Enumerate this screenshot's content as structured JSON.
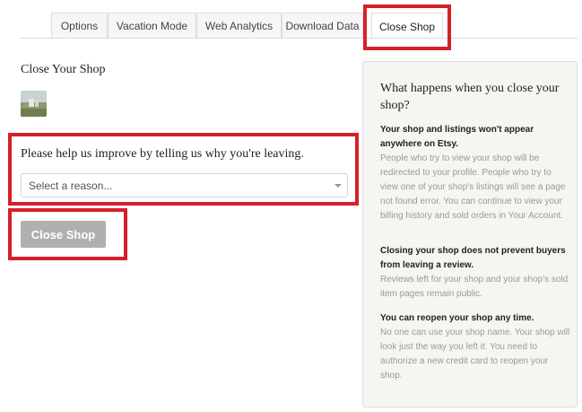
{
  "tabs": {
    "options": "Options",
    "vacation": "Vacation Mode",
    "analytics": "Web Analytics",
    "download": "Download Data",
    "close": "Close Shop"
  },
  "main": {
    "heading": "Close Your Shop",
    "reason_label": "Please help us improve by telling us why you're leaving.",
    "reason_placeholder": "Select a reason...",
    "close_button": "Close Shop"
  },
  "info": {
    "title": "What happens when you close your shop?",
    "sections": [
      {
        "bold": "Your shop and listings won't appear anywhere on Etsy.",
        "text": "People who try to view your shop will be redirected to your profile. People who try to view one of your shop's listings will see a page not found error. You can continue to view your billing history and sold orders in Your Account."
      },
      {
        "bold": "Closing your shop does not prevent buyers from leaving a review.",
        "text": "Reviews left for your shop and your shop's sold item pages remain public."
      },
      {
        "bold": "You can reopen your shop any time.",
        "text": "No one can use your shop name. Your shop will look just the way you left it. You need to authorize a new credit card to reopen your shop."
      }
    ]
  },
  "colors": {
    "highlight": "#d6202a",
    "button_disabled": "#b0b0b0",
    "info_bg": "#f5f5f1"
  }
}
